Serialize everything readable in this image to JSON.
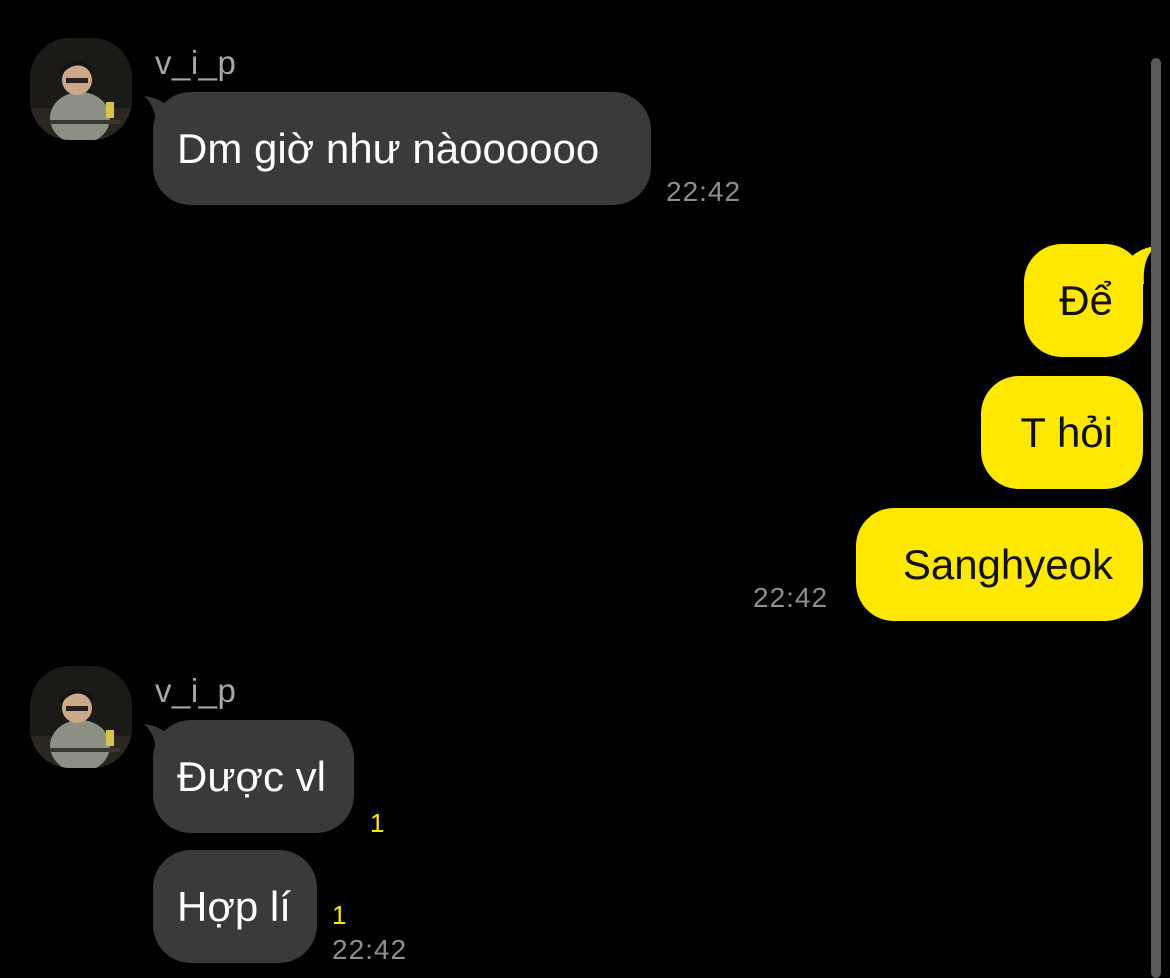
{
  "colors": {
    "background": "#000000",
    "incoming_bubble": "#3a3a3c",
    "outgoing_bubble": "#ffe800",
    "timestamp": "#8e8e93",
    "unread_count": "#ffe800",
    "sender_name": "#a6a6a6"
  },
  "messages": {
    "group1": {
      "sender": "v_i_p",
      "avatar_icon": "profile-photo-icon",
      "m1": {
        "text": "Dm giờ như nàoooooo",
        "time": "22:42"
      }
    },
    "group2": {
      "m1": {
        "text": "Để"
      },
      "m2": {
        "text": "T hỏi"
      },
      "m3": {
        "text": "Sanghyeok",
        "time": "22:42"
      }
    },
    "group3": {
      "sender": "v_i_p",
      "avatar_icon": "profile-photo-icon",
      "m1": {
        "text": "Được vl",
        "unread": "1"
      },
      "m2": {
        "text": "Hợp lí",
        "unread": "1",
        "time": "22:42"
      }
    }
  }
}
